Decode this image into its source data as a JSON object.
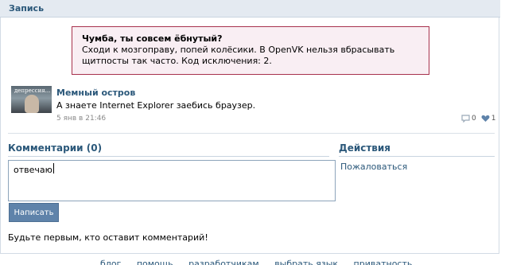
{
  "header": {
    "title": "Запись"
  },
  "error": {
    "title": "Чумба, ты совсем ёбнутый?",
    "message": "Сходи к мозгоправу, попей колёсики. В OpenVK нельзя вбрасывать щитпосты так часто. Код исключения: 2."
  },
  "post": {
    "avatar_caption": "депрессия...",
    "author": "Мемный остров",
    "text": "А знаете Internet Explorer заебись браузер.",
    "date": "5 янв в 21:46",
    "comments_count": "0",
    "likes_count": "1",
    "comment_icon": "comment-icon",
    "like_icon": "heart-icon"
  },
  "comments": {
    "heading": "Комментарии (0)",
    "input_value": "отвечаю",
    "submit_label": "Написать",
    "empty_text": "Будьте первым, кто оставит комментарий!"
  },
  "actions": {
    "heading": "Действия",
    "report_label": "Пожаловаться"
  },
  "footer": {
    "links": [
      "блог",
      "помощь",
      "разработчикам",
      "выбрать язык",
      "приватность"
    ]
  },
  "colors": {
    "accent": "#2b587a",
    "header_bg": "#e4eaf1",
    "error_bg": "#f9eef3",
    "error_border": "#a8324d",
    "button_bg": "#5f83aa"
  }
}
